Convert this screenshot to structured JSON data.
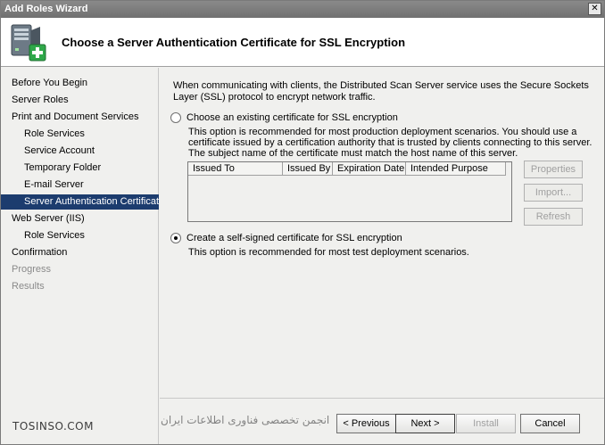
{
  "window": {
    "title": "Add Roles Wizard",
    "close_glyph": "✕"
  },
  "header": {
    "title": "Choose a Server Authentication Certificate for SSL Encryption",
    "icon": "server-add-icon"
  },
  "nav": {
    "items": [
      {
        "label": "Before You Begin",
        "level": 0,
        "state": "normal"
      },
      {
        "label": "Server Roles",
        "level": 0,
        "state": "normal"
      },
      {
        "label": "Print and Document Services",
        "level": 0,
        "state": "normal"
      },
      {
        "label": "Role Services",
        "level": 1,
        "state": "normal"
      },
      {
        "label": "Service Account",
        "level": 1,
        "state": "normal"
      },
      {
        "label": "Temporary Folder",
        "level": 1,
        "state": "normal"
      },
      {
        "label": "E-mail Server",
        "level": 1,
        "state": "normal"
      },
      {
        "label": "Server Authentication Certificate",
        "level": 1,
        "state": "selected"
      },
      {
        "label": "Web Server (IIS)",
        "level": 0,
        "state": "normal"
      },
      {
        "label": "Role Services",
        "level": 1,
        "state": "normal"
      },
      {
        "label": "Confirmation",
        "level": 0,
        "state": "normal"
      },
      {
        "label": "Progress",
        "level": 0,
        "state": "disabled"
      },
      {
        "label": "Results",
        "level": 0,
        "state": "disabled"
      }
    ]
  },
  "content": {
    "intro": "When communicating with clients, the Distributed Scan Server service uses the Secure Sockets Layer (SSL) protocol to encrypt network traffic.",
    "option_existing": {
      "label": "Choose an existing certificate for SSL encryption",
      "checked": false,
      "description": "This option is recommended for most production deployment scenarios. You should use a certificate issued by a certification authority that is trusted by clients connecting to this server.  The subject name of the certificate must match the host name of this server."
    },
    "table": {
      "columns": [
        "Issued To",
        "Issued By",
        "Expiration Date",
        "Intended Purpose"
      ],
      "rows": []
    },
    "side_buttons": {
      "properties": "Properties",
      "import": "Import...",
      "refresh": "Refresh"
    },
    "option_selfsigned": {
      "label": "Create a self-signed certificate for SSL encryption",
      "checked": true,
      "description": "This option is recommended for most test deployment scenarios."
    }
  },
  "footer": {
    "previous": "< Previous",
    "next": "Next >",
    "install": "Install",
    "cancel": "Cancel"
  },
  "watermark": {
    "left": "TOSINSO.COM",
    "right": "انجمن تخصصی فناوری اطلاعات ایران"
  },
  "colors": {
    "nav_selected": "#1c3c6e",
    "titlebar": "#7a7a7a",
    "panel": "#f0f0ee"
  }
}
